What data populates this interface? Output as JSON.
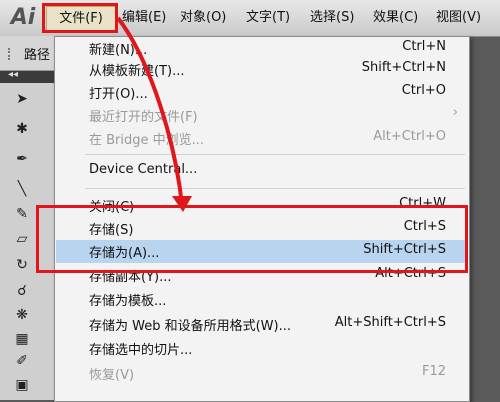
{
  "app": {
    "logo": "Ai"
  },
  "menubar": {
    "items": [
      "文件(F)",
      "编辑(E)",
      "对象(O)",
      "文字(T)",
      "选择(S)",
      "效果(C)",
      "视图(V)"
    ]
  },
  "toolbar": {
    "label": "路径"
  },
  "panel": {
    "collapse": "◂◂"
  },
  "file_menu": {
    "items": [
      {
        "label": "新建(N)...",
        "shortcut": "Ctrl+N"
      },
      {
        "label": "从模板新建(T)...",
        "shortcut": "Shift+Ctrl+N"
      },
      {
        "label": "打开(O)...",
        "shortcut": "Ctrl+O"
      },
      {
        "label": "最近打开的文件(F)",
        "shortcut": ""
      },
      {
        "label": "在 Bridge 中浏览...",
        "shortcut": "Alt+Ctrl+O"
      },
      {
        "label": "Device Central...",
        "shortcut": ""
      },
      {
        "label": "关闭(C)",
        "shortcut": "Ctrl+W"
      },
      {
        "label": "存储(S)",
        "shortcut": "Ctrl+S"
      },
      {
        "label": "存储为(A)...",
        "shortcut": "Shift+Ctrl+S"
      },
      {
        "label": "存储副本(Y)...",
        "shortcut": "Alt+Ctrl+S"
      },
      {
        "label": "存储为模板...",
        "shortcut": ""
      },
      {
        "label": "存储为 Web 和设备所用格式(W)...",
        "shortcut": "Alt+Shift+Ctrl+S"
      },
      {
        "label": "存储选中的切片...",
        "shortcut": ""
      },
      {
        "label": "恢复(V)",
        "shortcut": "F12"
      }
    ]
  },
  "colors": {
    "highlight": "#e0161a",
    "active_row": "#b9d4ee"
  }
}
